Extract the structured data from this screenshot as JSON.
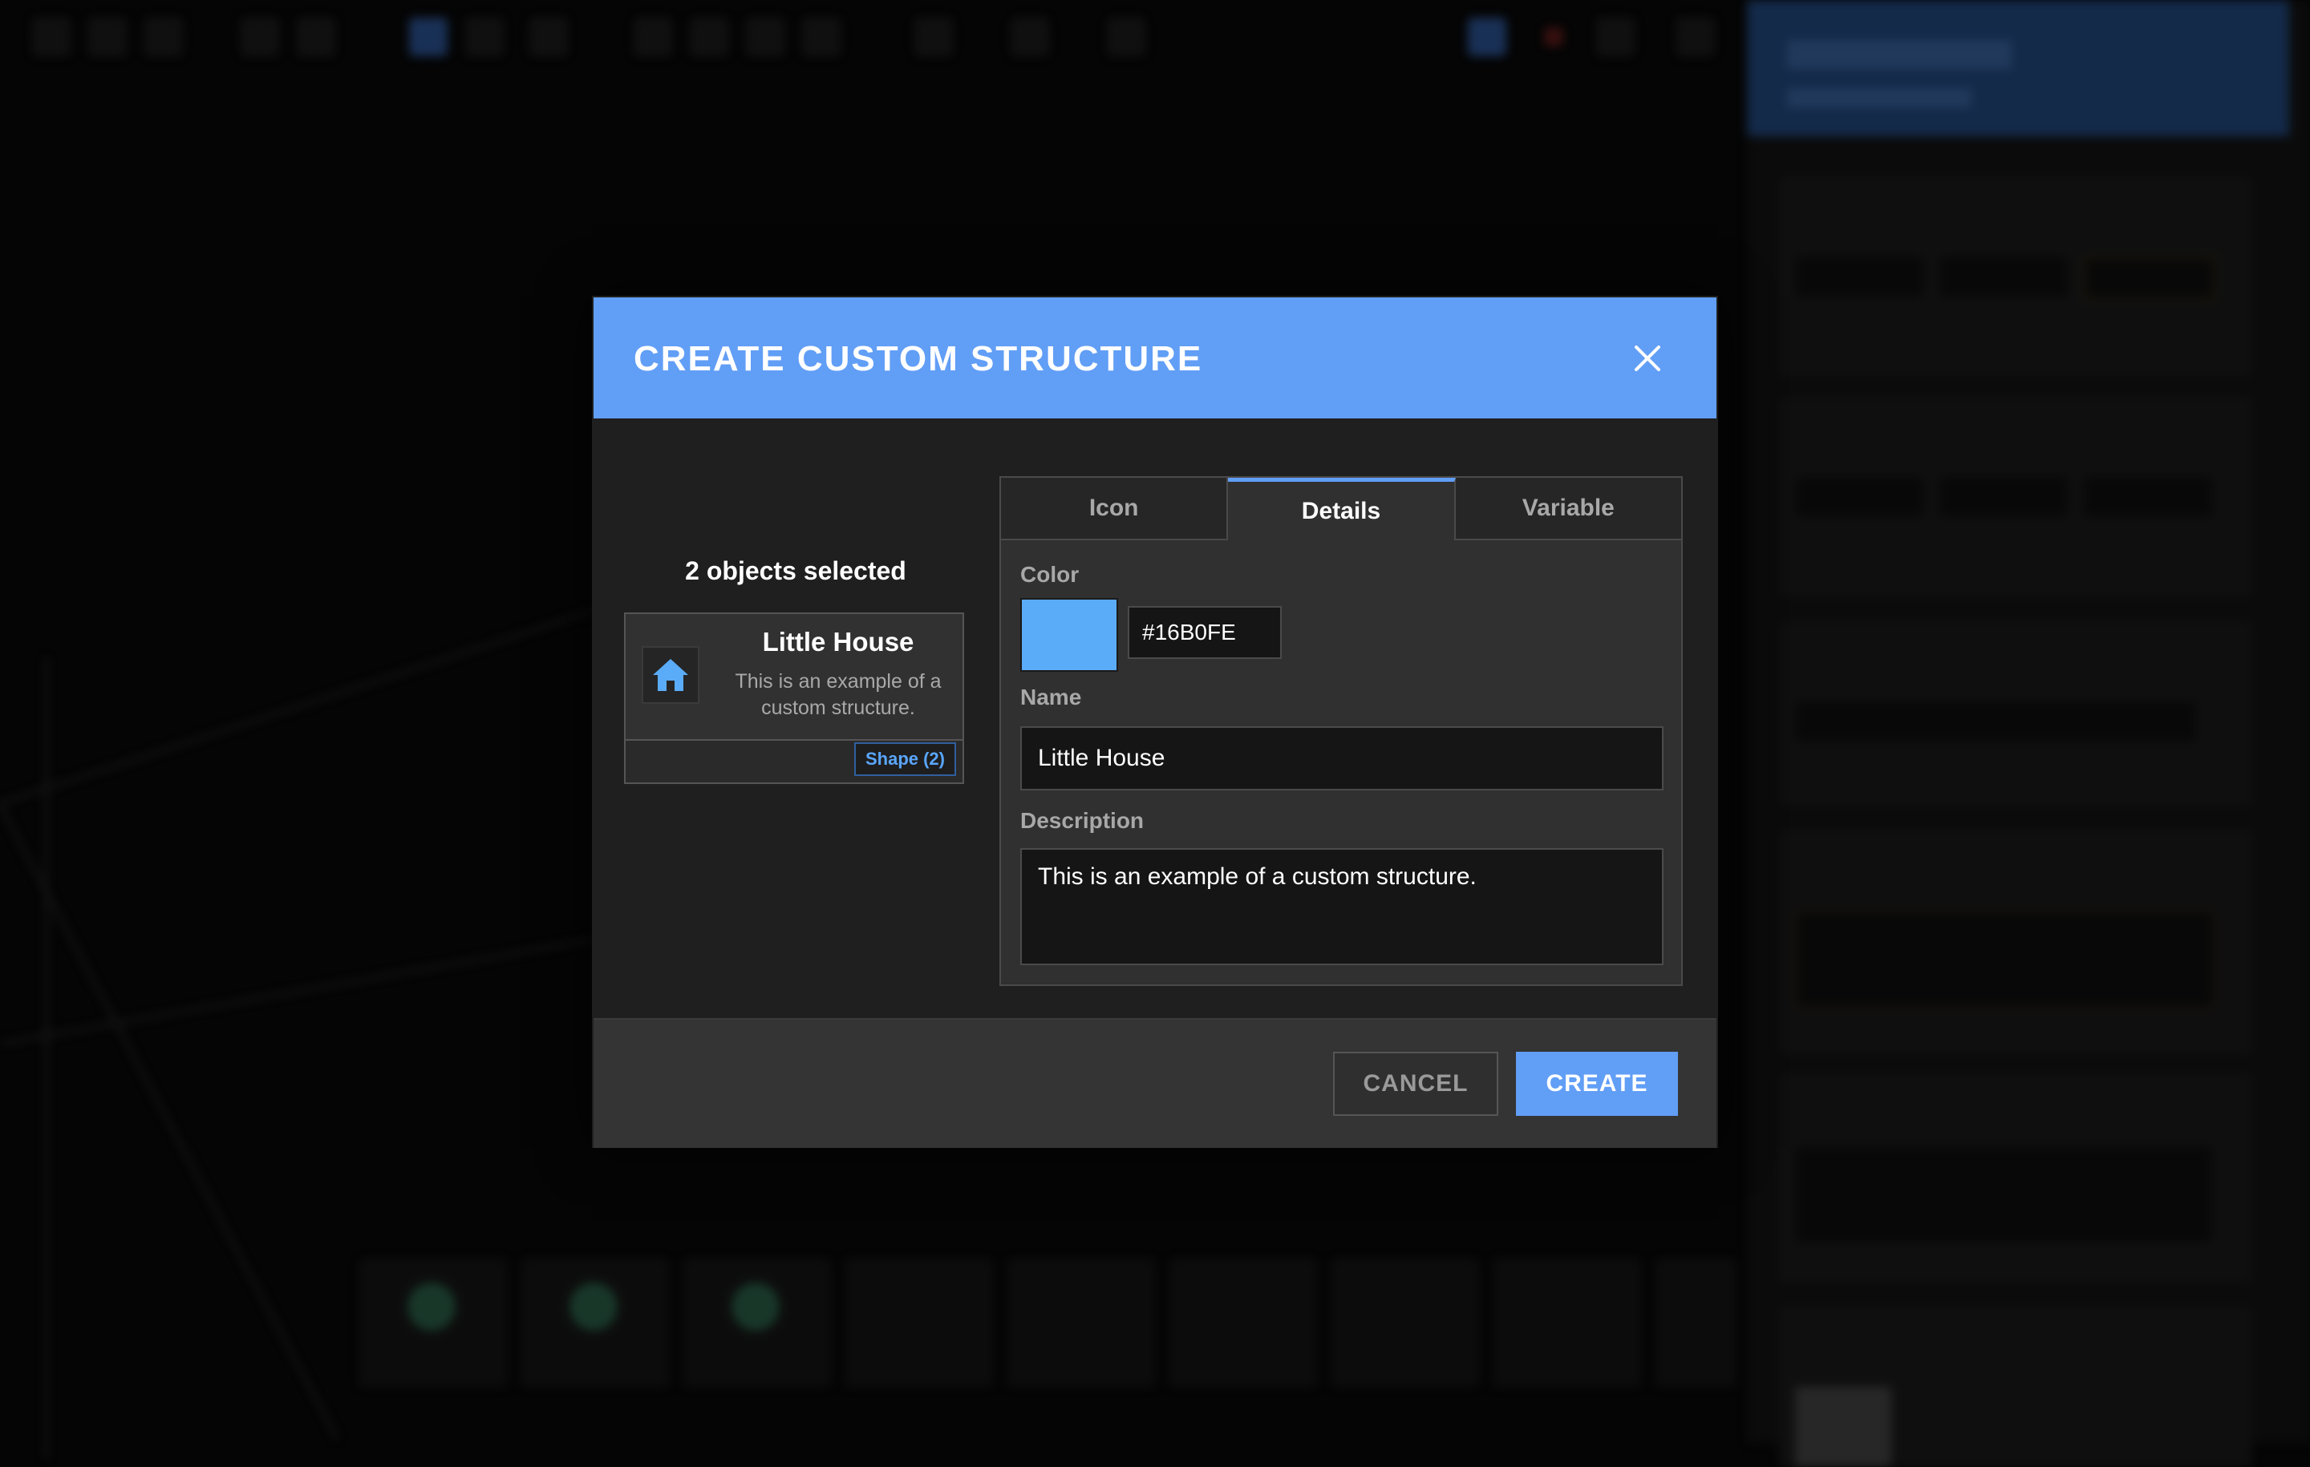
{
  "modal": {
    "title": "CREATE CUSTOM STRUCTURE",
    "selection_count": "2 objects selected",
    "preview": {
      "name": "Little House",
      "description": "This is an example of a custom structure.",
      "badge": "Shape (2)",
      "icon": "house-icon",
      "icon_color": "#16B0FE"
    },
    "tabs": [
      {
        "label": "Icon",
        "active": false
      },
      {
        "label": "Details",
        "active": true
      },
      {
        "label": "Variable",
        "active": false
      }
    ],
    "details": {
      "color_label": "Color",
      "color_value": "#16B0FE",
      "name_label": "Name",
      "name_value": "Little House",
      "description_label": "Description",
      "description_value": "This is an example of a custom structure."
    },
    "footer": {
      "cancel_label": "CANCEL",
      "create_label": "CREATE"
    }
  },
  "colors": {
    "accent": "#619EF6",
    "swatch": "#5AACF8",
    "background": "#050505",
    "modal_body": "#1F1F1F"
  }
}
